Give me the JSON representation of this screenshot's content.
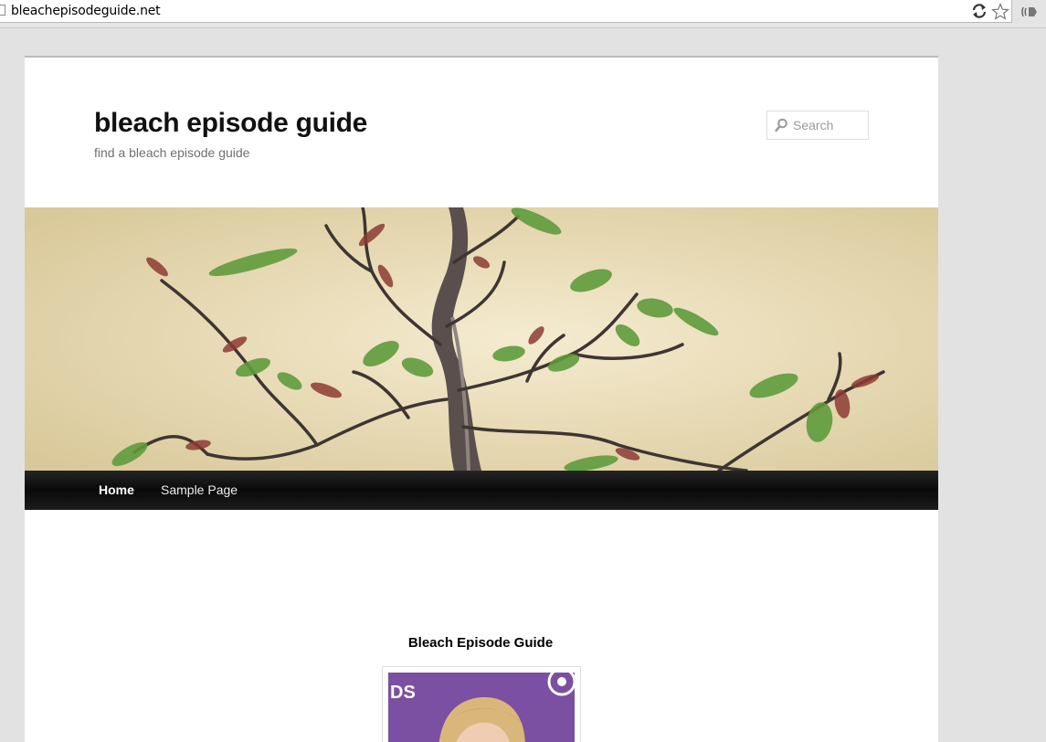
{
  "browser": {
    "url": "bleachepisodeguide.net",
    "icons": [
      "page-icon",
      "reload-icon",
      "star-icon",
      "extension-icon"
    ]
  },
  "site": {
    "title": "bleach episode guide",
    "description": "find a bleach episode guide"
  },
  "search": {
    "placeholder": "Search"
  },
  "nav": {
    "items": [
      {
        "label": "Home"
      },
      {
        "label": "Sample Page"
      }
    ]
  },
  "post": {
    "title": "Bleach Episode Guide",
    "photo_sign_text": "DS"
  }
}
